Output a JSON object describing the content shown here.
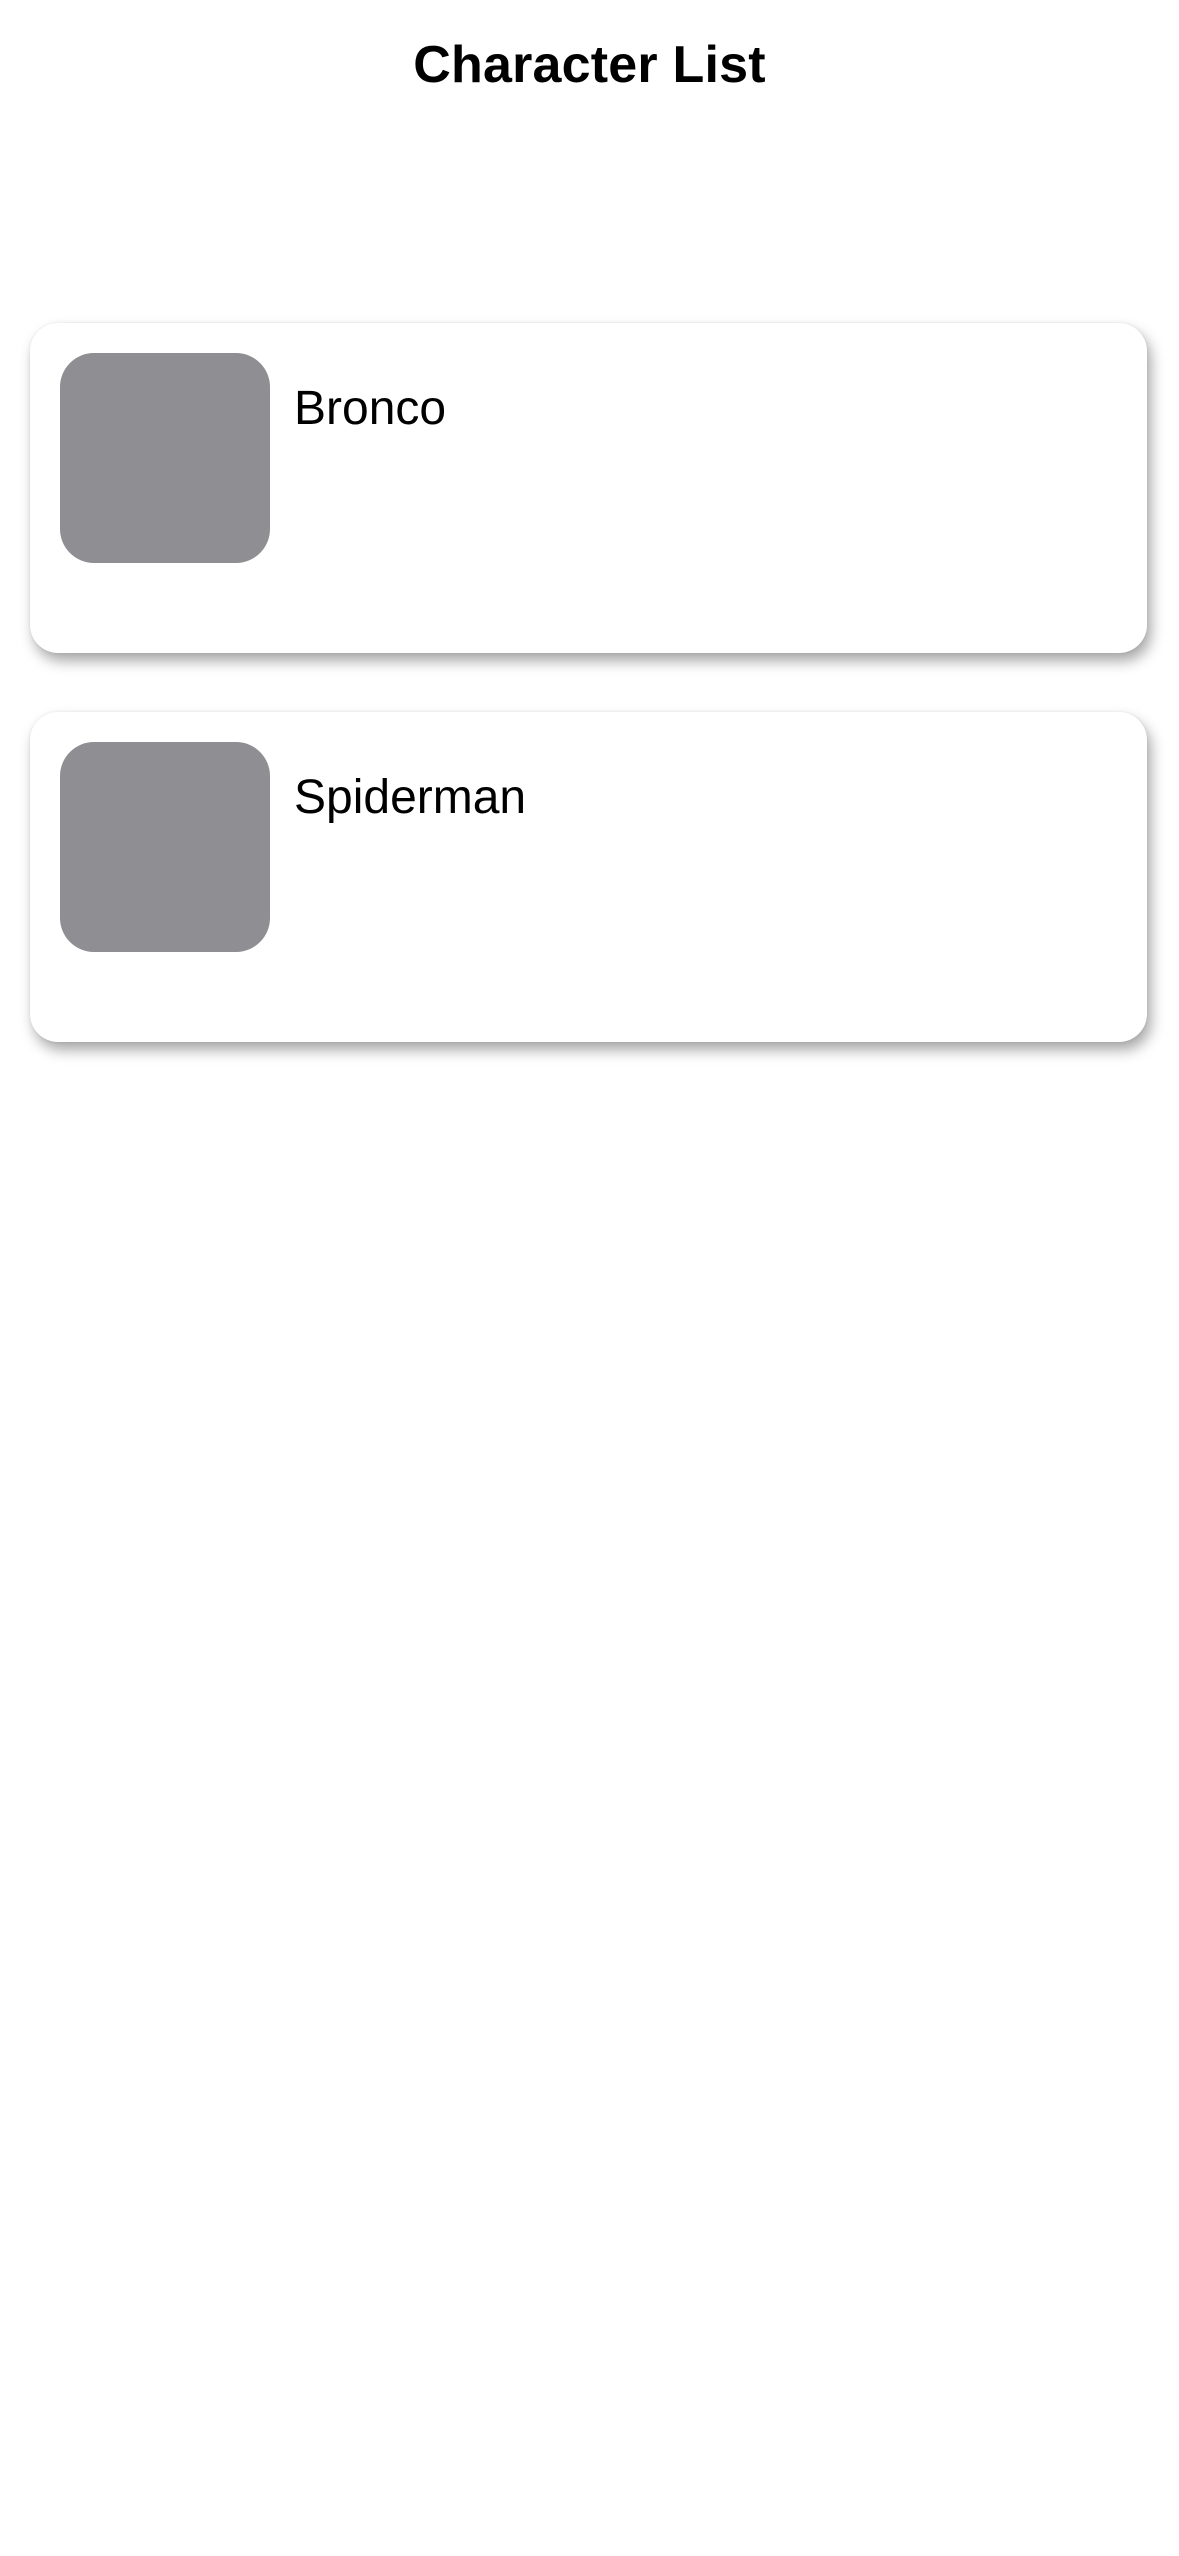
{
  "header": {
    "title": "Character List"
  },
  "characters": [
    {
      "name": "Bronco",
      "thumbnail_color": "#8e8e93"
    },
    {
      "name": "Spiderman",
      "thumbnail_color": "#8e8e93"
    }
  ],
  "colors": {
    "background": "#ffffff",
    "card": "#ffffff",
    "text": "#000000",
    "placeholder": "#8e8e93"
  }
}
